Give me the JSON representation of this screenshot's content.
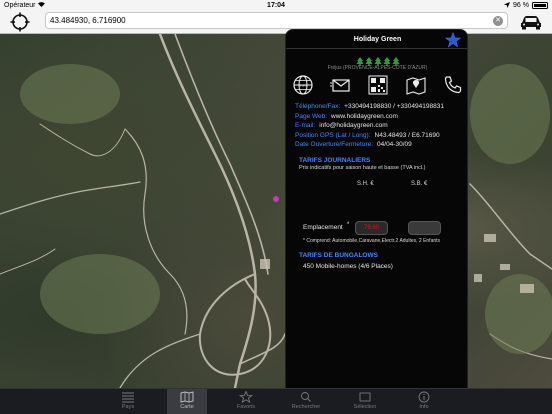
{
  "status_bar": {
    "carrier": "Opérateur",
    "time": "17:04",
    "battery_text": "96 %",
    "battery_level": 0.96
  },
  "nav": {
    "coordinates_value": "43.484930, 6.716900"
  },
  "panel": {
    "title": "Holiday Green",
    "rating_stars": 5,
    "location": "Fréjus (PROVENCE-ALPES-CÔTE D'AZUR)",
    "details": [
      {
        "label": "Téléphone/Fax:",
        "value": "+330494198830 / +330494198831"
      },
      {
        "label": "Page Web:",
        "value": "www.holidaygreen.com"
      },
      {
        "label": "E-mail:",
        "value": "info@holidaygreen.com"
      },
      {
        "label": "Position GPS (Lat / Long):",
        "value": "N43.48493 / E6.71690"
      },
      {
        "label": "Date Ouverture/Fermeture:",
        "value": "04/04-30/09"
      }
    ],
    "tarifs_title": "TARIFS JOURNALIERS",
    "tarifs_subtitle": "Prix indicatifs pour saison haute et basse (TVA incl.)",
    "col_high": "S.H. €",
    "col_low": "S.B. €",
    "emplacement_label": "Emplacement",
    "emplacement_asterisk": "*",
    "price_high": "79.60",
    "price_low": "",
    "note": "* Comprend: Automobile,Caravane,Electr.2 Adultes, 2 Enfants",
    "bungalows_title": "TARIFS DE BUNGALOWS",
    "bungalows_text": "450 Mobile-homes  (4/6 Places)"
  },
  "tabs": [
    {
      "label": "Pays",
      "icon": "list-icon"
    },
    {
      "label": "Carte",
      "icon": "map-icon"
    },
    {
      "label": "Favoris",
      "icon": "star-icon"
    },
    {
      "label": "Rechercher",
      "icon": "search-icon"
    },
    {
      "label": "Sélection",
      "icon": "selection-icon"
    },
    {
      "label": "Info",
      "icon": "info-icon"
    }
  ],
  "active_tab": 1,
  "colors": {
    "accent_blue": "#3f87ff",
    "rating_green": "#2e9e3a",
    "price_red": "#dd1111"
  }
}
